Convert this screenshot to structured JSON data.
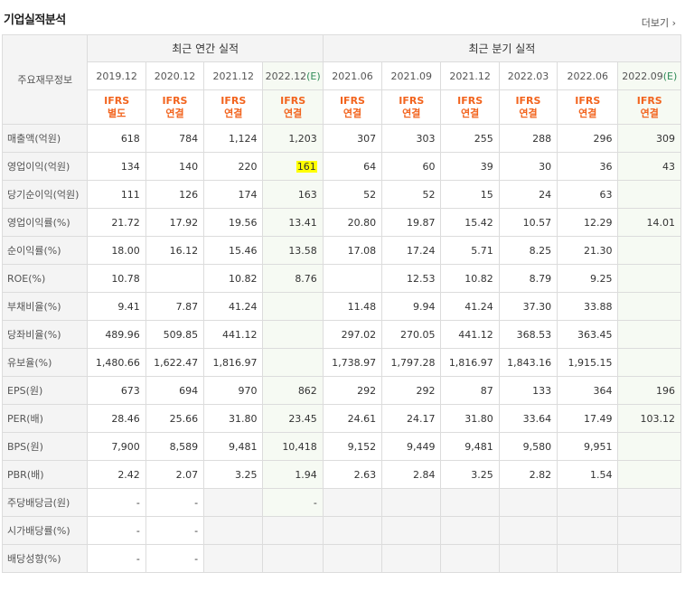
{
  "title": "기업실적분석",
  "more": "더보기",
  "row_header_label": "주요재무정보",
  "groups": {
    "annual": "최근 연간 실적",
    "quarterly": "최근 분기 실적"
  },
  "periods": [
    "2019.12",
    "2020.12",
    "2021.12",
    "2022.12(E)",
    "2021.06",
    "2021.09",
    "2021.12",
    "2022.03",
    "2022.06",
    "2022.09(E)"
  ],
  "accounting": [
    [
      "IFRS",
      "별도"
    ],
    [
      "IFRS",
      "연결"
    ],
    [
      "IFRS",
      "연결"
    ],
    [
      "IFRS",
      "연결"
    ],
    [
      "IFRS",
      "연결"
    ],
    [
      "IFRS",
      "연결"
    ],
    [
      "IFRS",
      "연결"
    ],
    [
      "IFRS",
      "연결"
    ],
    [
      "IFRS",
      "연결"
    ],
    [
      "IFRS",
      "연결"
    ]
  ],
  "rows": [
    {
      "label": "매출액(억원)",
      "values": [
        "618",
        "784",
        "1,124",
        "1,203",
        "307",
        "303",
        "255",
        "288",
        "296",
        "309"
      ]
    },
    {
      "label": "영업이익(억원)",
      "values": [
        "134",
        "140",
        "220",
        "161",
        "64",
        "60",
        "39",
        "30",
        "36",
        "43"
      ]
    },
    {
      "label": "당기순이익(억원)",
      "values": [
        "111",
        "126",
        "174",
        "163",
        "52",
        "52",
        "15",
        "24",
        "63",
        ""
      ]
    },
    {
      "label": "영업이익률(%)",
      "values": [
        "21.72",
        "17.92",
        "19.56",
        "13.41",
        "20.80",
        "19.87",
        "15.42",
        "10.57",
        "12.29",
        "14.01"
      ]
    },
    {
      "label": "순이익률(%)",
      "values": [
        "18.00",
        "16.12",
        "15.46",
        "13.58",
        "17.08",
        "17.24",
        "5.71",
        "8.25",
        "21.30",
        ""
      ]
    },
    {
      "label": "ROE(%)",
      "values": [
        "10.78",
        "",
        "10.82",
        "8.76",
        "",
        "12.53",
        "10.82",
        "8.79",
        "9.25",
        ""
      ]
    },
    {
      "label": "부채비율(%)",
      "values": [
        "9.41",
        "7.87",
        "41.24",
        "",
        "11.48",
        "9.94",
        "41.24",
        "37.30",
        "33.88",
        ""
      ]
    },
    {
      "label": "당좌비율(%)",
      "values": [
        "489.96",
        "509.85",
        "441.12",
        "",
        "297.02",
        "270.05",
        "441.12",
        "368.53",
        "363.45",
        ""
      ]
    },
    {
      "label": "유보율(%)",
      "values": [
        "1,480.66",
        "1,622.47",
        "1,816.97",
        "",
        "1,738.97",
        "1,797.28",
        "1,816.97",
        "1,843.16",
        "1,915.15",
        ""
      ]
    },
    {
      "label": "EPS(원)",
      "values": [
        "673",
        "694",
        "970",
        "862",
        "292",
        "292",
        "87",
        "133",
        "364",
        "196"
      ]
    },
    {
      "label": "PER(배)",
      "values": [
        "28.46",
        "25.66",
        "31.80",
        "23.45",
        "24.61",
        "24.17",
        "31.80",
        "33.64",
        "17.49",
        "103.12"
      ]
    },
    {
      "label": "BPS(원)",
      "values": [
        "7,900",
        "8,589",
        "9,481",
        "10,418",
        "9,152",
        "9,449",
        "9,481",
        "9,580",
        "9,951",
        ""
      ]
    },
    {
      "label": "PBR(배)",
      "values": [
        "2.42",
        "2.07",
        "3.25",
        "1.94",
        "2.63",
        "2.84",
        "3.25",
        "2.82",
        "1.54",
        ""
      ]
    },
    {
      "label": "주당배당금(원)",
      "values": [
        "-",
        "-",
        "",
        "-",
        "",
        "",
        "",
        "",
        "",
        ""
      ]
    },
    {
      "label": "시가배당률(%)",
      "values": [
        "-",
        "-",
        "",
        "",
        "",
        "",
        "",
        "",
        "",
        ""
      ]
    },
    {
      "label": "배당성향(%)",
      "values": [
        "-",
        "-",
        "",
        "",
        "",
        "",
        "",
        "",
        "",
        ""
      ]
    }
  ],
  "highlight": {
    "row": 1,
    "col": 3,
    "color": "#ffff00"
  },
  "colors": {
    "accounting_text": "#f2641e",
    "estimate_text": "#2e8b57",
    "header_bg": "#f4f4f4",
    "estimate_bg": "#f6faf3"
  }
}
